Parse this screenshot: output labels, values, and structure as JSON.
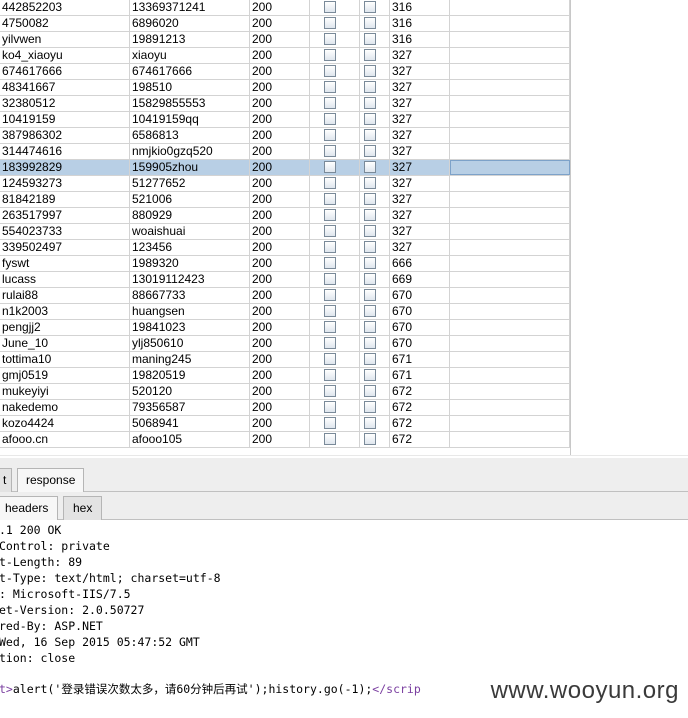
{
  "table": {
    "selected_index": 10,
    "rows": [
      [
        "442852203",
        "13369371241",
        "200",
        "316"
      ],
      [
        "4750082",
        "6896020",
        "200",
        "316"
      ],
      [
        "yilvwen",
        "19891213",
        "200",
        "316"
      ],
      [
        "ko4_xiaoyu",
        "xiaoyu",
        "200",
        "327"
      ],
      [
        "674617666",
        "674617666",
        "200",
        "327"
      ],
      [
        "48341667",
        "198510",
        "200",
        "327"
      ],
      [
        "32380512",
        "15829855553",
        "200",
        "327"
      ],
      [
        "10419159",
        "10419159qq",
        "200",
        "327"
      ],
      [
        "387986302",
        "6586813",
        "200",
        "327"
      ],
      [
        "314474616",
        "nmjkio0gzq520",
        "200",
        "327"
      ],
      [
        "183992829",
        "159905zhou",
        "200",
        "327"
      ],
      [
        "124593273",
        "51277652",
        "200",
        "327"
      ],
      [
        "81842189",
        "521006",
        "200",
        "327"
      ],
      [
        "263517997",
        "880929",
        "200",
        "327"
      ],
      [
        "554023733",
        "woaishuai",
        "200",
        "327"
      ],
      [
        "339502497",
        "123456",
        "200",
        "327"
      ],
      [
        "fyswt",
        "1989320",
        "200",
        "666"
      ],
      [
        "lucass",
        "13019112423",
        "200",
        "669"
      ],
      [
        "rulai88",
        "88667733",
        "200",
        "670"
      ],
      [
        "n1k2003",
        "huangsen",
        "200",
        "670"
      ],
      [
        "pengjj2",
        "19841023",
        "200",
        "670"
      ],
      [
        "June_10",
        "ylj850610",
        "200",
        "670"
      ],
      [
        "tottima10",
        "maning245",
        "200",
        "671"
      ],
      [
        "gmj0519",
        "19820519",
        "200",
        "671"
      ],
      [
        "mukeyiyi",
        "520120",
        "200",
        "672"
      ],
      [
        "nakedemo",
        "79356587",
        "200",
        "672"
      ],
      [
        "kozo4424",
        "5068941",
        "200",
        "672"
      ],
      [
        "afooo.cn",
        "afooo105",
        "200",
        "672"
      ]
    ]
  },
  "tabs": {
    "request_fragment": "t",
    "response": "response",
    "headers": "headers",
    "hex": "hex"
  },
  "response": {
    "header_lines": [
      ".1 200 OK",
      "Control: private",
      "t-Length: 89",
      "t-Type: text/html; charset=utf-8",
      ": Microsoft-IIS/7.5",
      "et-Version: 2.0.50727",
      "red-By: ASP.NET",
      "Wed, 16 Sep 2015 05:47:52 GMT",
      "tion: close"
    ],
    "body_open_fragment": "t>",
    "body_script": "alert('登录错误次数太多，请60分钟后再试');history.go(-1);",
    "body_close_tag": "</scrip"
  },
  "watermark": "www.wooyun.org"
}
